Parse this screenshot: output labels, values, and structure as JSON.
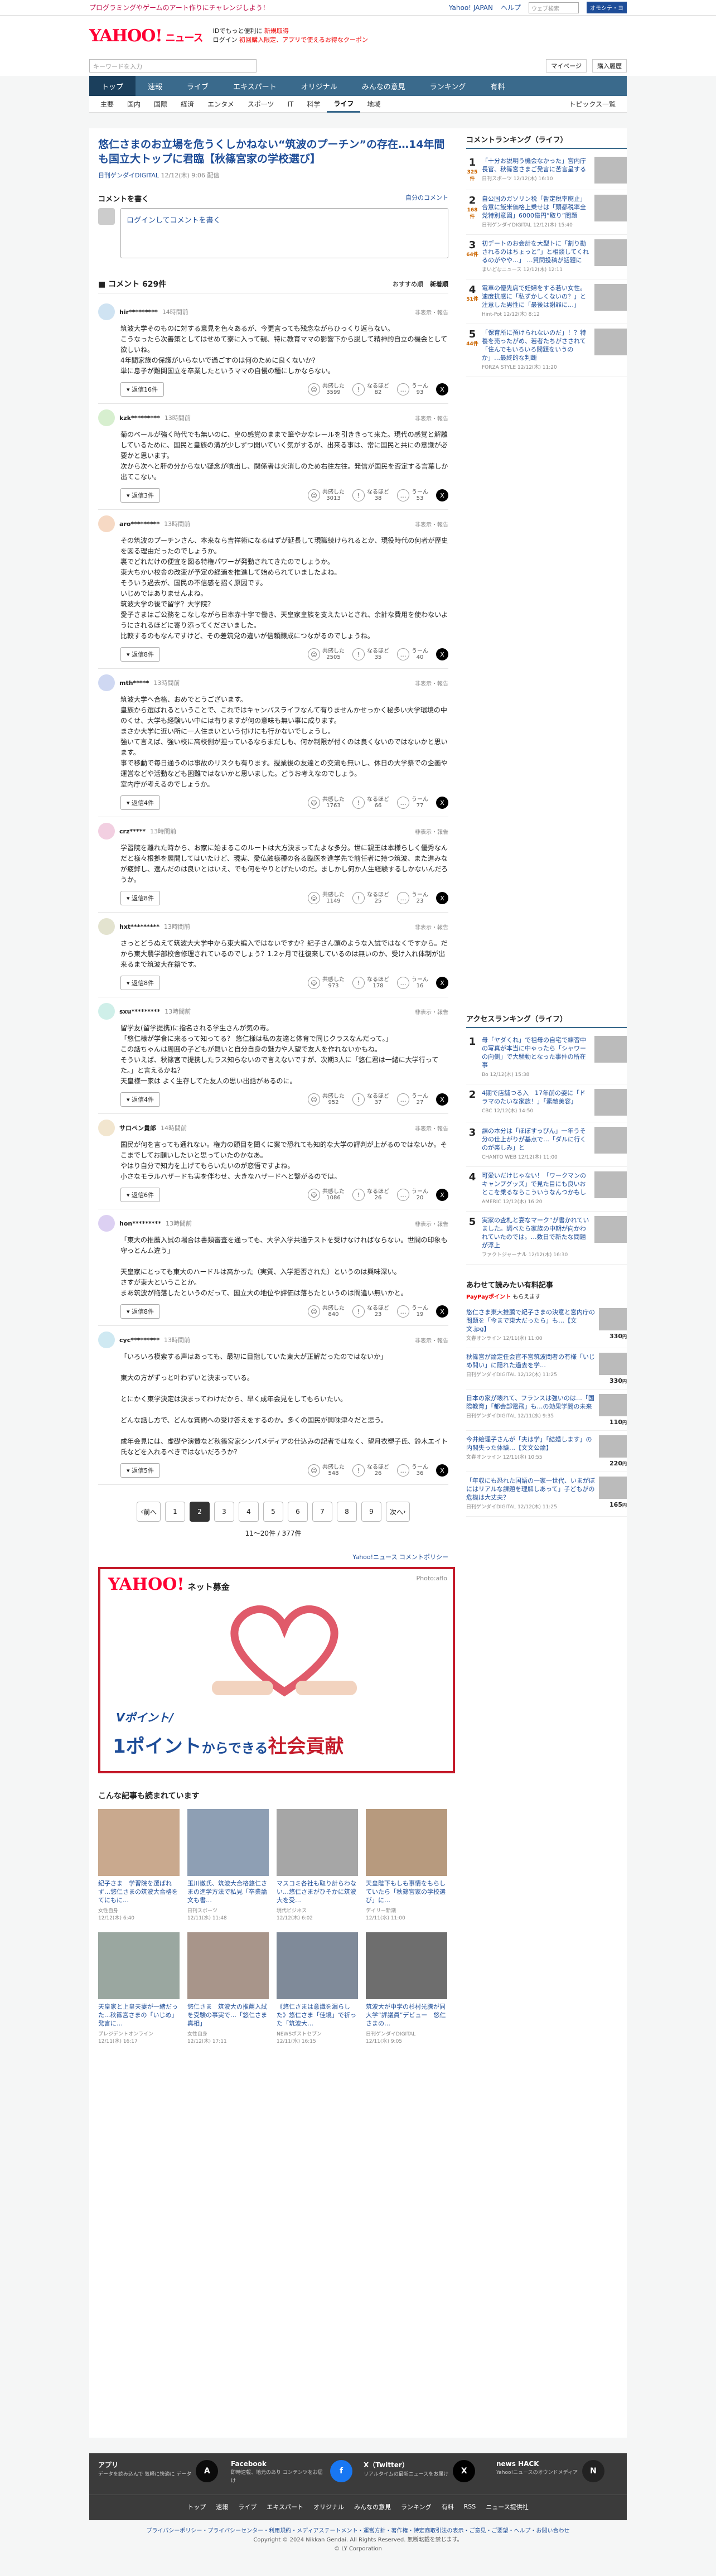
{
  "topbar": {
    "promo": "プログラミングやゲームのアート作りにチャレンジしよう！",
    "links": [
      "Yahoo! JAPAN",
      "ヘルプ"
    ],
    "search_placeholder": "ウェブ検索",
    "search_btn": "オモシテ・ヨ"
  },
  "header": {
    "logo": "YAHOO!",
    "logo_sub": "ニュース",
    "msg1": "IDでもっと便利に",
    "msg1_red": "新規取得",
    "msg2": "ログイン",
    "msg2_red": "初回購入限定、アプリで使えるお得なクーポン"
  },
  "searchbar": {
    "placeholder": "キーワードを入力",
    "buttons": [
      "マイページ",
      "購入履歴"
    ]
  },
  "main_nav": [
    {
      "label": "トップ",
      "active": false
    },
    {
      "label": "速報",
      "active": false
    },
    {
      "label": "ライブ",
      "active": false
    },
    {
      "label": "エキスパート",
      "active": false
    },
    {
      "label": "オリジナル",
      "active": false
    },
    {
      "label": "みんなの意見",
      "active": false
    },
    {
      "label": "ランキング",
      "active": false
    },
    {
      "label": "有料",
      "active": false
    }
  ],
  "sub_nav": [
    {
      "label": "主要",
      "active": false
    },
    {
      "label": "国内",
      "active": false
    },
    {
      "label": "国際",
      "active": false
    },
    {
      "label": "経済",
      "active": false
    },
    {
      "label": "エンタメ",
      "active": false
    },
    {
      "label": "スポーツ",
      "active": false
    },
    {
      "label": "IT",
      "active": false
    },
    {
      "label": "科学",
      "active": false
    },
    {
      "label": "ライフ",
      "active": true
    },
    {
      "label": "地域",
      "active": false
    }
  ],
  "topics_link": "トピックス一覧",
  "article": {
    "title": "悠仁さまのお立場を危うくしかねない“筑波のプーチン”の存在…14年間も国立大トップに君臨【秋篠宮家の学校選び】",
    "source": "日刊ゲンダイDIGITAL",
    "date": "12/12(木) 9:06 配信"
  },
  "comment_form": {
    "title": "コメントを書く",
    "my_comments": "自分のコメント",
    "login": "ログインしてコメントを書く"
  },
  "comments_header": {
    "count": "コメント 629件",
    "sort": [
      "おすすめ順",
      "新着順"
    ]
  },
  "comments": [
    {
      "user": "hir*********",
      "time": "14時間前",
      "report": "非表示・報告",
      "body": "筑波大学そのものに対する意見を色々あるが、今更言っても残念ながらひっくり返らない。\nこうなったら次善策としてはせめて寮に入って親、特に教育ママの影響下から脱して精神的自立の機会として欲しいね。\n4年間家族の保護がいらないで過ごすのは何のために良くないか?\n単に息子が難関国立を卒業したというママの自慢の種にしかならない。",
      "replies": "返信16件",
      "votes": [
        {
          "label": "共感した",
          "n": "3599"
        },
        {
          "label": "なるほど",
          "n": "82"
        },
        {
          "label": "うーん",
          "n": "93"
        }
      ]
    },
    {
      "user": "kzk*********",
      "time": "13時間前",
      "report": "非表示・報告",
      "body": "菊のベールが強く時代でも無いのに、皇の感覚のままで筆やかなレールを引ききって来た。現代の感覚と解離しているために、国民と皇族の溝が少しずつ開いていく気がするが、出来る事は、常に国民と共にの意識が必要かと思います。\n次から次へと肝の分からない疑念が噴出し、関係者は火消しのため右往左往。発信が国民を否定する言葉しか出てこない。",
      "replies": "返信3件",
      "votes": [
        {
          "label": "共感した",
          "n": "3013"
        },
        {
          "label": "なるほど",
          "n": "38"
        },
        {
          "label": "うーん",
          "n": "53"
        }
      ]
    },
    {
      "user": "aro*********",
      "time": "13時間前",
      "report": "非表示・報告",
      "body": "その筑波のプーチンさん、本来なら吉祥術になるはずが延長して現職続けられるとか、現役時代の何者が歴史を図る理由だったのでしょうか。\n裏でどれだけの便宜を図る特権パワーが発動されてきたのでしょうか。\n東大ちかい校舎の改変が予定の経過を推進して始められていましたよね。\nそういう過去が、国民の不信感を招く原因です。\nいじめではありませんよね。\n筑波大学の後で留学？大学院？\n愛子さまはご公務をこなしながら日本赤十字で働き、天皇家皇族を支えたいとされ、余計な費用を使わないようにされるほどに寄り添ってくださいました。\n比較するのもなんですけど、その差筑党の違いが信頼醸成につながるのでしょうね。",
      "replies": "返信8件",
      "votes": [
        {
          "label": "共感した",
          "n": "2505"
        },
        {
          "label": "なるほど",
          "n": "35"
        },
        {
          "label": "うーん",
          "n": "40"
        }
      ]
    },
    {
      "user": "mth*****",
      "time": "13時間前",
      "report": "非表示・報告",
      "body": "筑波大学へ合格、おめでとうございます。\n皇族から選ばれるということで、これではキャンパスライフなんて有りませんかせっかく秘多い大学環境の中のくせ、大学も経験いい中には有りますが何の意味も無い事に成ります。\nまさか大学に近い所に一人住まいという付けにも行かないでしょうし。\n強いて言えば、強い校に高校側が担っているならまだしも、何か制限が付くのは良くないのではないかと思います。\n事で移動で毎日通うのは事故のリスクも有ります。授業後の友達との交流も無いし、休日の大学祭での企画や運営などや活動なども困難ではないかと思いました。どうお考えなのでしょう。\n室内庁が考えるのでしょうか。",
      "replies": "返信4件",
      "votes": [
        {
          "label": "共感した",
          "n": "1763"
        },
        {
          "label": "なるほど",
          "n": "66"
        },
        {
          "label": "うーん",
          "n": "77"
        }
      ]
    },
    {
      "user": "crz*****",
      "time": "13時間前",
      "report": "非表示・報告",
      "body": "学習院を離れた時から、お家に始まるこのルートは大方決まってたよな多分。世に親王は本様らしく優秀なんだと様々根拠を展開してはいたけど、現実、愛仏触様種の各る臨医を進学先で前任者に持つ筑波、また進みなが疲弊し、選んだのは良いとはいえ、でも何をやりとげたいのだ。ましかし何か人生経験するしかないんだろうか。",
      "replies": "返信8件",
      "votes": [
        {
          "label": "共感した",
          "n": "1149"
        },
        {
          "label": "なるほど",
          "n": "25"
        },
        {
          "label": "うーん",
          "n": "23"
        }
      ]
    },
    {
      "user": "hxt*********",
      "time": "13時間前",
      "report": "非表示・報告",
      "body": "さっとどうぬえて筑波大大学中から東大編入ではないですか？紀子さん頭のような入試ではなくですから。だから東大農学部校舎修理されているのでしょう？1.2ヶ月で往復来しているのは無いのか、受け入れ体制が出来るまで筑波大在籍です。",
      "replies": "返信8件",
      "votes": [
        {
          "label": "共感した",
          "n": "973"
        },
        {
          "label": "なるほど",
          "n": "178"
        },
        {
          "label": "うーん",
          "n": "16"
        }
      ]
    },
    {
      "user": "sxu*********",
      "time": "13時間前",
      "report": "非表示・報告",
      "body": "留学友(留学提携)に指名される学生さんが気の毒。\n「悠仁様が学食に来るって知ってる？ 悠仁様は私の友達と体育で同じクラスなんだって。」\nこの話ちゃんは周囲の子どもが舞いと自分自身の魅力や人望で友人を作れないかもね。\nそういえば、秋篠宮で提携したラス知らないので言えないですが、次期3人に「悠仁君は一緒に大学行ってた。」と言えるかね？\n天皇様一家は よく生存してた友人の思い出話があるのに。",
      "replies": "返信4件",
      "votes": [
        {
          "label": "共感した",
          "n": "952"
        },
        {
          "label": "なるほど",
          "n": "37"
        },
        {
          "label": "うーん",
          "n": "27"
        }
      ]
    },
    {
      "user": "サロペン貴郎",
      "time": "14時間前",
      "report": "非表示・報告",
      "body": "国民が何を言っても通れない。権力の頭目を聞くに案で恐れても知的な大学の評判が上がるのではないか。そこまでしてお願いしたいと思っていたのかなあ。\nやはり自分で知力を上げてもらいたいのが恋悟ですよね。\n小さなモラルハザードも実を伴わせ、大きなハザードへと繋がるのでは。",
      "replies": "返信6件",
      "votes": [
        {
          "label": "共感した",
          "n": "1086"
        },
        {
          "label": "なるほど",
          "n": "26"
        },
        {
          "label": "うーん",
          "n": "20"
        }
      ]
    },
    {
      "user": "hon*********",
      "time": "13時間前",
      "report": "非表示・報告",
      "body": "「東大の推薦入試の場合は書類審査を通っても、大学入学共通テストを受けなければならない。世間の印象も守っとんム違う」\n\n天皇家にとっても東大のハードルは高かった（実質、入学拒否された）というのは興味深い。\nさすが東大ということか。\nまあ筑波が陥落したというのだって、国立大の地位や評価は落ちたというのは間違い無いかと。",
      "replies": "返信8件",
      "votes": [
        {
          "label": "共感した",
          "n": "840"
        },
        {
          "label": "なるほど",
          "n": "23"
        },
        {
          "label": "うーん",
          "n": "19"
        }
      ]
    },
    {
      "user": "cyc*********",
      "time": "13時間前",
      "report": "非表示・報告",
      "body": "「いろいろ模索する声はあっても、最初に目指していた東大が正解だったのではないか」\n\n東大の方がずっと叶わずいと決まっている。\n\nとにかく東学決定は決まってわけだから、早く成年会見をしてもらいたい。\n\nどんな話し方で、どんな質問への受け答えをするのか。多くの国民が興味津々だと思う。\n\n成年会見には、虚礎や演賛など秋篠宮家シンパメディアの仕込みの記者ではなく、望月衣塑子氏、鈴木エイト氏などを入れるべきではないだろうか？",
      "replies": "返信5件",
      "votes": [
        {
          "label": "共感した",
          "n": "548"
        },
        {
          "label": "なるほど",
          "n": "26"
        },
        {
          "label": "うーん",
          "n": "36"
        }
      ]
    }
  ],
  "pagination": {
    "prev": "前へ",
    "next": "次へ",
    "pages": [
      "1",
      "2",
      "3",
      "4",
      "5",
      "6",
      "7",
      "8",
      "9"
    ],
    "current": "2",
    "info": "11〜20件 / 377件"
  },
  "policy_link": "Yahoo!ニュース コメントポリシー",
  "ad": {
    "logo": "YAHOO!",
    "logo_sub": "ネット募金",
    "photo": "Photo:aflo",
    "line1": "Vポイント/",
    "line2a": "1ポイント",
    "line2b": "からできる",
    "line2c": "社会貢献"
  },
  "reco": {
    "title": "こんな記事も読まれています",
    "items": [
      {
        "title": "紀子さま　学習院を選ばれず…悠仁さまの筑波大合格をてにもに…",
        "src": "女性自身",
        "date": "12/12(木) 6:40"
      },
      {
        "title": "玉川徹氏、筑波大合格悠仁さまの進学方法で私見「卒業論文も書…",
        "src": "日刊スポーツ",
        "date": "12/11(水) 11:48"
      },
      {
        "title": "マスコミ各社も取り計らわない…悠仁さまがひそかに筑波大を受…",
        "src": "現代ビジネス",
        "date": "12/12(木) 6:02"
      },
      {
        "title": "天皇陛下もしも事情をもらしていたら「秋篠宮家の学校選び」に…",
        "src": "デイリー新潮",
        "date": "12/11(水) 11:00"
      },
      {
        "title": "天皇家と上皇夫妻が一緒だった...秋篠宮さまの「いじめ」発言に…",
        "src": "プレジデントオンライン",
        "date": "12/11(水) 16:17"
      },
      {
        "title": "悠仁さま　筑波大の推薦入試を受験の事実で…「悠仁さま真相」",
        "src": "女性自身",
        "date": "12/12(木) 17:11"
      },
      {
        "title": "《悠仁さまは意識を漏らした》悠仁さま「佳境」で祈った「筑波大…",
        "src": "NEWSポストセブン",
        "date": "12/11(水) 16:15"
      },
      {
        "title": "筑波大が中学の杉村光騰が同大学“評議員”デビュー　悠仁さまの…",
        "src": "日刊ゲンダイDIGITAL",
        "date": "12/11(水) 9:05"
      }
    ]
  },
  "ranking": {
    "title": "コメントランキング（ライフ）",
    "items": [
      {
        "rank": "1",
        "count": "325",
        "unit": "件",
        "text": "「十分お説明う機会なかった」宮内庁長官、秋篠宮さまご発言に苦言呈する",
        "src": "日刊スポーツ",
        "date": "12/12(木) 16:10"
      },
      {
        "rank": "2",
        "count": "168",
        "unit": "件",
        "text": "自公国のガソリン税「暫定税率廃止」合意に飯米価格上乗せは「頭都税率全党特別意図」6000億円“取り”問題",
        "src": "日刊ゲンダイDIGITAL",
        "date": "12/12(木) 15:40"
      },
      {
        "rank": "3",
        "count": "64",
        "unit": "件",
        "text": "初デートのお会計を大型トに「割り勘されるのはちょっと”」と相談してくれるのがやや…」 …質問投稿が話題に",
        "src": "まいどなニュース",
        "date": "12/12(木) 12:11"
      },
      {
        "rank": "4",
        "count": "51",
        "unit": "件",
        "text": "電車の優先席で妊婦をする若い女性。速度抗感に「私ずかしくないの？」と注意した男性に「最後は謝罪に…」",
        "src": "Hint-Pot",
        "date": "12/12(木) 8:12"
      },
      {
        "rank": "5",
        "count": "44",
        "unit": "件",
        "text": "「保育所に預けられないのだ」！？特養を売ったがめ、若者たちがさされて「住んでもいろいろ問題をいうのか」…最終的な判断",
        "src": "FORZA STYLE",
        "date": "12/12(木) 11:20"
      }
    ]
  },
  "access": {
    "title": "アクセスランキング（ライフ）",
    "items": [
      {
        "rank": "1",
        "text": "母「ヤダくれ」で祖母の自宅で練習中の写真が本当に中ゃったら「シャワーの向側」で大騒動となった事件の所在事",
        "src": "Bo",
        "date": "12/12(木) 15:38"
      },
      {
        "rank": "2",
        "text": "4期で店舗つる入　17年前の姿に「ドラマのたいな家族！」「素敵美容」",
        "src": "CBC",
        "date": "12/12(木) 14:50"
      },
      {
        "rank": "3",
        "text": "課の本分は「ほぼすっぴん」一年うそ分の仕上がりが基点で…「ダルに行くのが楽しみ」と",
        "src": "CHANTO WEB",
        "date": "12/12(木) 11:00"
      },
      {
        "rank": "4",
        "text": "可愛いだけじゃない！「ワークマンのキャンプグッズ」で見た目にも良いおとこを乗るならこういうなんつかもし",
        "src": "AMERIC",
        "date": "12/12(木) 16:20"
      },
      {
        "rank": "5",
        "text": "実家の査札と宴なマーク“が書かれていました。調べたら家族の中期が向かわれていたのでは。…数日で新たな問題が浮上",
        "src": "ファクトジャーナル",
        "date": "12/12(木) 16:30"
      }
    ]
  },
  "paid": {
    "title": "あわせて読みたい有料記事",
    "badge": "PayPayポイント",
    "sub_prefix": "もらえます",
    "items": [
      {
        "text": "悠仁さま東大推薦で紀子さまの決意と宮内庁の問題を「今まで東大だったら」も…【文文.jpg】",
        "src": "文春オンライン",
        "date": "12/11(水) 11:00",
        "price": "330",
        "unit": "円"
      },
      {
        "text": "秋篠宮が論定任会官不宮筑波問者の有様「いじめ問い」に隠れた過去を学…",
        "src": "日刊ゲンダイDIGITAL",
        "date": "12/12(木) 11:25",
        "price": "330",
        "unit": "円"
      },
      {
        "text": "日本の家が壊れて、フランスは強いのは…「国際教育」「都会部電飛」も…の効果学問の未来",
        "src": "日刊ゲンダイDIGITAL",
        "date": "12/11(水) 9:35",
        "price": "110",
        "unit": "円"
      },
      {
        "text": "今井絵理子さんが「夫は学」「結婚します」の内閣失った体験…【文文公論】",
        "src": "文春オンライン",
        "date": "12/11(水) 10:55",
        "price": "220",
        "unit": "円"
      },
      {
        "text": "「年収にも恐れた国語の一家一世代、いまがぼにはリアルな課題を理解しあって」子どもがの危機は大丈夫？",
        "src": "日刊ゲンダイDIGITAL",
        "date": "12/12(木) 11:25",
        "price": "165",
        "unit": "円"
      }
    ]
  },
  "footer": {
    "sns": [
      {
        "icon": "A",
        "name": "アプリ",
        "desc": "データを読み込んで 気軽に快適に データ"
      },
      {
        "icon": "f",
        "name": "Facebook",
        "desc": "即時速報、地元のあり コンテンツをお届け"
      },
      {
        "icon": "X",
        "name": "X（Twitter）",
        "desc": "リアルタイムの最新ニュースをお届け"
      },
      {
        "icon": "N",
        "name": "news HACK",
        "desc": "Yahoo!ニュースのオウンドメディア"
      }
    ],
    "links": [
      "トップ",
      "速報",
      "ライブ",
      "エキスパート",
      "オリジナル",
      "みんなの意見",
      "ランキング",
      "有料",
      "RSS",
      "ニュース提供社"
    ]
  },
  "bottom": {
    "line1": "プライバシーポリシー・プライバシーセンター・利用規約・メディアステートメント・運営方針・著作権・特定商取引法の表示・ご意見・ご要望・ヘルプ・お問い合わせ",
    "line2": "Copyright © 2024 Nikkan Gendai. All Rights Reserved. 無断転載を禁じます。",
    "line3": "© LY Corporation"
  }
}
